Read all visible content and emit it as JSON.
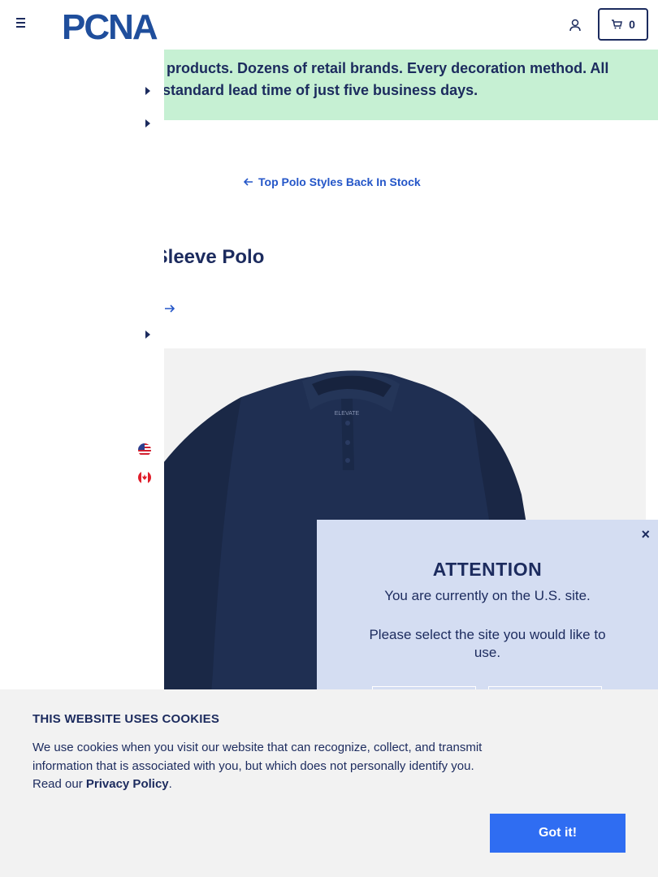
{
  "header": {
    "logo_text": "PCNA",
    "cart_count": "0"
  },
  "banner": {
    "line1": "ls of products. Dozens of retail brands. Every decoration method. All",
    "line2": "th a standard lead time of just five business days."
  },
  "nav": {
    "back_link": "Top Polo Styles Back In Stock"
  },
  "product": {
    "title": "ong Sleeve Polo",
    "image_brand": "ELEVATE"
  },
  "attention": {
    "close": "×",
    "title": "ATTENTION",
    "message": "You are currently on the U.S. site.",
    "prompt": "Please select the site you would like to use."
  },
  "cookie": {
    "title": "THIS WEBSITE USES COOKIES",
    "body": "We use cookies when you visit our website that can recognize, collect, and transmit information that is associated with you, but which does not personally identify you. Read our",
    "link": "Privacy Policy",
    "period": ".",
    "button": "Got it!"
  },
  "colors": {
    "navy": "#1c2b5e",
    "banner_green": "#c6f0d3",
    "link_blue": "#2456c8",
    "modal_bg": "#d4ddf2",
    "button_blue": "#2f6df2"
  },
  "icons": [
    "hamburger-icon",
    "account-icon",
    "cart-icon",
    "caret-right-icon",
    "arrow-left-icon",
    "arrow-right-icon",
    "us-flag-icon",
    "canada-flag-icon",
    "close-icon"
  ]
}
